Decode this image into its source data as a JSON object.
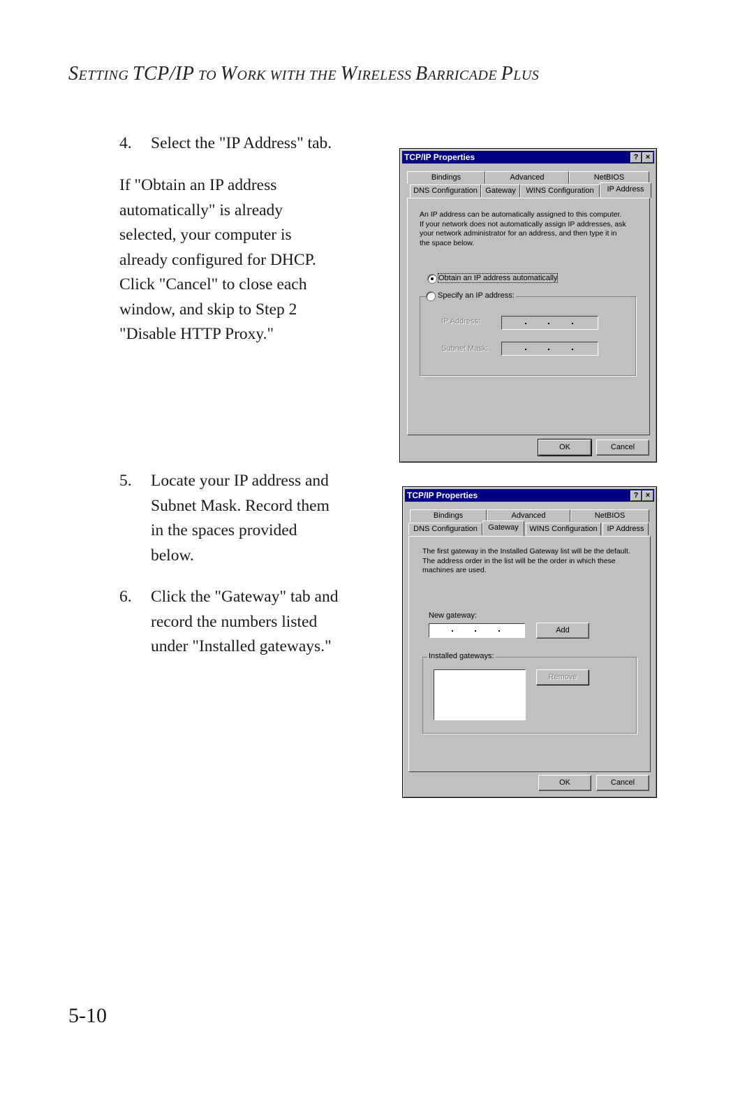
{
  "running_head": {
    "parts": [
      "S",
      "etting ",
      "TCP/IP",
      " to ",
      "W",
      "ork with the ",
      "W",
      "ireless ",
      "B",
      "arricade ",
      "P",
      "lus"
    ]
  },
  "steps": {
    "step4": {
      "number": "4.",
      "text": "Select the \"IP Address\" tab."
    },
    "note": "If \"Obtain an IP address\nautomatically\" is already\nselected, your computer is\nalready configured for DHCP.\nClick \"Cancel\" to close each\nwindow, and skip to Step 2\n\"Disable HTTP Proxy.\"",
    "step5": {
      "number": "5.",
      "lines": [
        "Locate your IP address and",
        "Subnet Mask. Record them",
        "in the spaces provided",
        "below."
      ]
    },
    "step6": {
      "number": "6.",
      "lines": [
        "Click the \"Gateway\" tab and",
        "record the numbers listed",
        "under \"Installed gateways.\""
      ]
    }
  },
  "page_number": "5-10",
  "dialog1": {
    "title": "TCP/IP Properties",
    "help_icon": "?",
    "close_icon": "×",
    "tabs_back": [
      "Bindings",
      "Advanced",
      "NetBIOS"
    ],
    "tabs_front": [
      "DNS Configuration",
      "Gateway",
      "WINS Configuration",
      "IP Address"
    ],
    "active_tab": "IP Address",
    "description": "An IP address can be automatically assigned to this computer.\nIf your network does not automatically assign IP addresses, ask\nyour network administrator for an address, and then type it in\nthe space below.",
    "radio_auto": "Obtain an IP address automatically",
    "radio_specify": "Specify an IP address:",
    "ip_address_label": "IP Address:",
    "subnet_mask_label": "Subnet Mask:",
    "ok": "OK",
    "cancel": "Cancel"
  },
  "dialog2": {
    "title": "TCP/IP Properties",
    "help_icon": "?",
    "close_icon": "×",
    "tabs_back": [
      "Bindings",
      "Advanced",
      "NetBIOS"
    ],
    "tabs_front": [
      "DNS Configuration",
      "Gateway",
      "WINS Configuration",
      "IP Address"
    ],
    "active_tab": "Gateway",
    "description": "The first gateway in the Installed Gateway list will be the default.\nThe address order in the list will be the order in which these\nmachines are used.",
    "new_gateway_label": "New gateway:",
    "add": "Add",
    "installed_gateways_label": "Installed gateways:",
    "remove": "Remove",
    "ok": "OK",
    "cancel": "Cancel"
  }
}
